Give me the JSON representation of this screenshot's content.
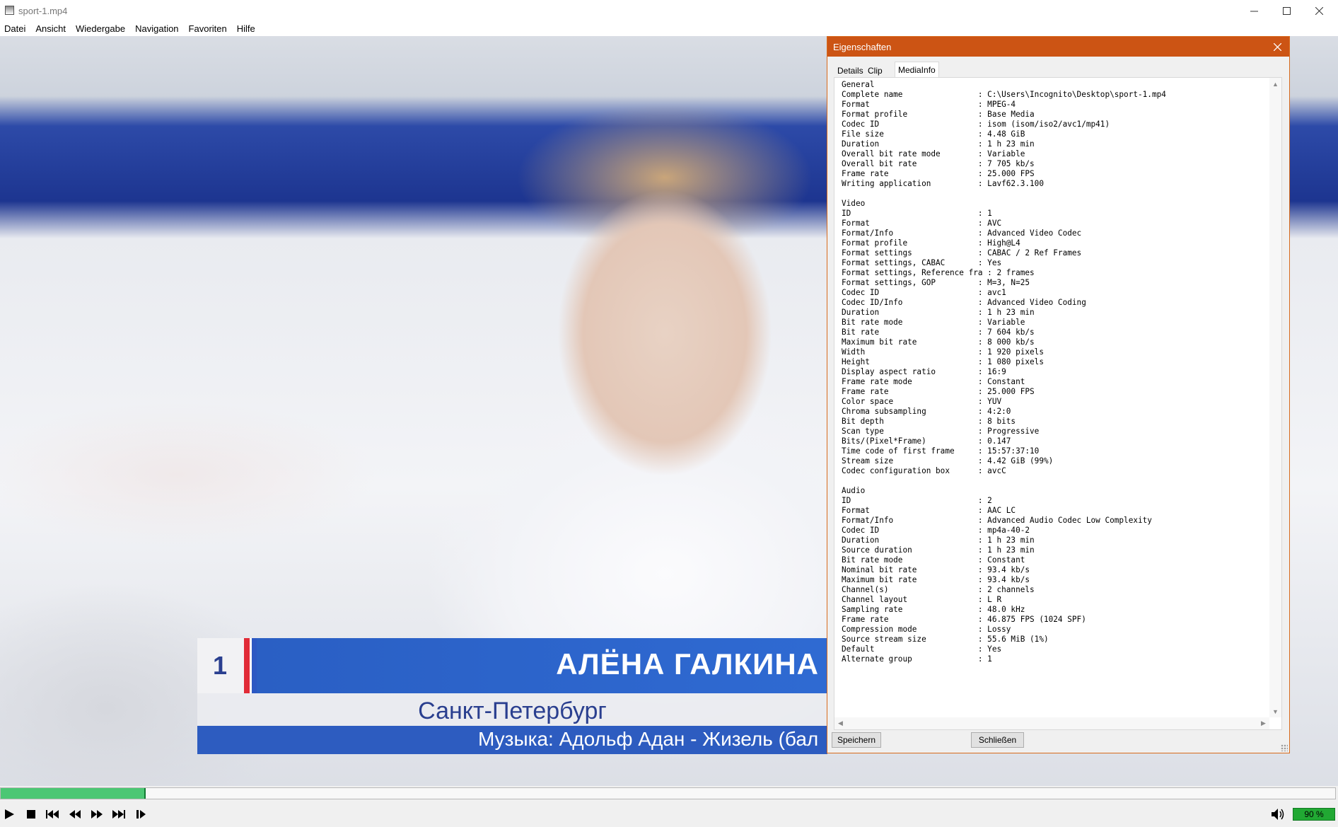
{
  "window": {
    "title": "sport-1.mp4"
  },
  "menu": [
    "Datei",
    "Ansicht",
    "Wiedergabe",
    "Navigation",
    "Favoriten",
    "Hilfe"
  ],
  "video_overlay": {
    "rank": "1",
    "name": "АЛЁНА ГАЛКИНА",
    "city": "Санкт-Петербург",
    "music": "Музыка: Адольф Адан - Жизель (бал"
  },
  "dialog": {
    "title": "Eigenschaften",
    "tabs": [
      "Details",
      "Clip",
      "MediaInfo"
    ],
    "active_tab": "MediaInfo",
    "mediainfo": "General\nComplete name                : C:\\Users\\Incognito\\Desktop\\sport-1.mp4\nFormat                       : MPEG-4\nFormat profile               : Base Media\nCodec ID                     : isom (isom/iso2/avc1/mp41)\nFile size                    : 4.48 GiB\nDuration                     : 1 h 23 min\nOverall bit rate mode        : Variable\nOverall bit rate             : 7 705 kb/s\nFrame rate                   : 25.000 FPS\nWriting application          : Lavf62.3.100\n\nVideo\nID                           : 1\nFormat                       : AVC\nFormat/Info                  : Advanced Video Codec\nFormat profile               : High@L4\nFormat settings              : CABAC / 2 Ref Frames\nFormat settings, CABAC       : Yes\nFormat settings, Reference fra : 2 frames\nFormat settings, GOP         : M=3, N=25\nCodec ID                     : avc1\nCodec ID/Info                : Advanced Video Coding\nDuration                     : 1 h 23 min\nBit rate mode                : Variable\nBit rate                     : 7 604 kb/s\nMaximum bit rate             : 8 000 kb/s\nWidth                        : 1 920 pixels\nHeight                       : 1 080 pixels\nDisplay aspect ratio         : 16:9\nFrame rate mode              : Constant\nFrame rate                   : 25.000 FPS\nColor space                  : YUV\nChroma subsampling           : 4:2:0\nBit depth                    : 8 bits\nScan type                    : Progressive\nBits/(Pixel*Frame)           : 0.147\nTime code of first frame     : 15:57:37:10\nStream size                  : 4.42 GiB (99%)\nCodec configuration box      : avcC\n\nAudio\nID                           : 2\nFormat                       : AAC LC\nFormat/Info                  : Advanced Audio Codec Low Complexity\nCodec ID                     : mp4a-40-2\nDuration                     : 1 h 23 min\nSource duration              : 1 h 23 min\nBit rate mode                : Constant\nNominal bit rate             : 93.4 kb/s\nMaximum bit rate             : 93.4 kb/s\nChannel(s)                   : 2 channels\nChannel layout               : L R\nSampling rate                : 48.0 kHz\nFrame rate                   : 46.875 FPS (1024 SPF)\nCompression mode             : Lossy\nSource stream size           : 55.6 MiB (1%)\nDefault                      : Yes\nAlternate group              : 1",
    "save_label": "Speichern",
    "close_label": "Schließen"
  },
  "player": {
    "progress": 0.108,
    "volume": "90 %",
    "colors": {
      "progress": "#4cc774",
      "volume": "#21a833",
      "dialog_accent": "#cc5414"
    }
  }
}
